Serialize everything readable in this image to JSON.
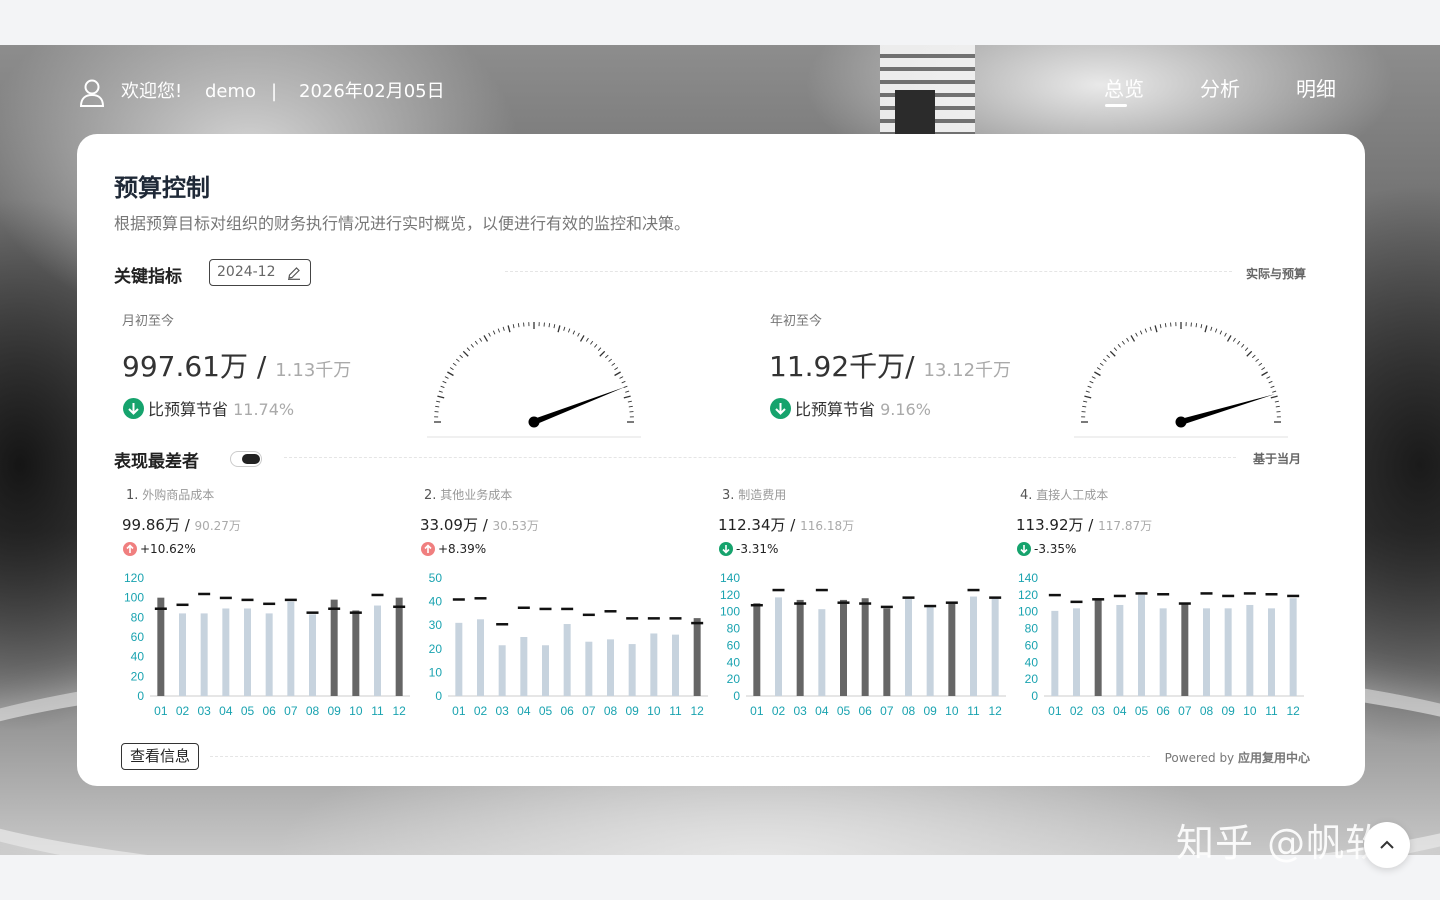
{
  "header": {
    "welcome": "欢迎您!",
    "username": "demo",
    "separator": "|",
    "date": "2026年02月05日",
    "nav": [
      {
        "label": "总览",
        "active": true
      },
      {
        "label": "分析",
        "active": false
      },
      {
        "label": "明细",
        "active": false
      }
    ]
  },
  "page": {
    "title": "预算控制",
    "subtitle": "根据预算目标对组织的财务执行情况进行实时概览，以便进行有效的监控和决策。"
  },
  "key_metrics": {
    "label": "关键指标",
    "period": "2024-12",
    "right_tag": "实际与预算",
    "mtd": {
      "label": "月初至今",
      "actual": "997.61万",
      "sep": " / ",
      "budget": "1.13千万",
      "status_text": "比预算节省",
      "status_pct": "11.74%",
      "gauge_ratio": 0.883
    },
    "ytd": {
      "label": "年初至今",
      "actual": "11.92千万",
      "sep": "/ ",
      "budget": "13.12千万",
      "status_text": "比预算节省",
      "status_pct": "9.16%",
      "gauge_ratio": 0.908
    }
  },
  "worst": {
    "label": "表现最差者",
    "right_tag": "基于当月",
    "items": [
      {
        "idx": "1.",
        "name": "外购商品成本",
        "actual": "99.86万",
        "budget": "90.27万",
        "change": "+10.62%",
        "direction": "up"
      },
      {
        "idx": "2.",
        "name": "其他业务成本",
        "actual": "33.09万",
        "budget": "30.53万",
        "change": "+8.39%",
        "direction": "up"
      },
      {
        "idx": "3.",
        "name": "制造费用",
        "actual": "112.34万",
        "budget": "116.18万",
        "change": "-3.31%",
        "direction": "down"
      },
      {
        "idx": "4.",
        "name": "直接人工成本",
        "actual": "113.92万",
        "budget": "117.87万",
        "change": "-3.35%",
        "direction": "down"
      }
    ]
  },
  "chart_data": [
    {
      "type": "bar",
      "categories": [
        "01",
        "02",
        "03",
        "04",
        "05",
        "06",
        "07",
        "08",
        "09",
        "10",
        "11",
        "12"
      ],
      "ylim": [
        0,
        120
      ],
      "yticks": [
        0,
        20,
        40,
        60,
        80,
        100,
        120
      ],
      "series": [
        {
          "values": [
            100,
            84,
            84,
            89,
            89,
            84,
            96,
            83,
            98,
            87,
            92,
            100
          ]
        },
        {
          "values": [
            89,
            93,
            104,
            100,
            98,
            94,
            98,
            85,
            89,
            85,
            103,
            91
          ]
        }
      ],
      "highlight": [
        true,
        false,
        false,
        false,
        false,
        false,
        false,
        false,
        true,
        true,
        false,
        true
      ]
    },
    {
      "type": "bar",
      "categories": [
        "01",
        "02",
        "03",
        "04",
        "05",
        "06",
        "07",
        "08",
        "09",
        "10",
        "11",
        "12"
      ],
      "ylim": [
        0,
        50
      ],
      "yticks": [
        0,
        10,
        20,
        30,
        40,
        50
      ],
      "series": [
        {
          "values": [
            31,
            32.5,
            21.5,
            25,
            21.5,
            30.5,
            23,
            24,
            22,
            26.5,
            26,
            33
          ]
        },
        {
          "values": [
            41,
            41.5,
            30.5,
            37.5,
            37,
            37,
            34.5,
            36,
            33,
            33,
            33,
            31
          ]
        }
      ],
      "highlight": [
        false,
        false,
        false,
        false,
        false,
        false,
        false,
        false,
        false,
        false,
        false,
        true
      ]
    },
    {
      "type": "bar",
      "categories": [
        "01",
        "02",
        "03",
        "04",
        "05",
        "06",
        "07",
        "08",
        "09",
        "10",
        "11",
        "12"
      ],
      "ylim": [
        0,
        140
      ],
      "yticks": [
        0,
        20,
        40,
        60,
        80,
        100,
        120,
        140
      ],
      "series": [
        {
          "values": [
            110,
            117,
            114,
            103,
            114,
            116,
            104,
            115,
            107,
            112,
            118,
            116
          ]
        },
        {
          "values": [
            108,
            126,
            110,
            126,
            111,
            110,
            106,
            117,
            107,
            111,
            126,
            117
          ]
        }
      ],
      "highlight": [
        true,
        false,
        true,
        false,
        true,
        true,
        true,
        false,
        false,
        true,
        false,
        false
      ]
    },
    {
      "type": "bar",
      "categories": [
        "01",
        "02",
        "03",
        "04",
        "05",
        "06",
        "07",
        "08",
        "09",
        "10",
        "11",
        "12"
      ],
      "ylim": [
        0,
        140
      ],
      "yticks": [
        0,
        20,
        40,
        60,
        80,
        100,
        120,
        140
      ],
      "series": [
        {
          "values": [
            101,
            104,
            116,
            108,
            120,
            104,
            110,
            104,
            104,
            108,
            104,
            116
          ]
        },
        {
          "values": [
            120,
            112,
            115,
            119,
            122,
            121,
            110,
            122,
            119,
            122,
            121,
            119
          ]
        }
      ],
      "highlight": [
        false,
        false,
        true,
        false,
        false,
        false,
        true,
        false,
        false,
        false,
        false,
        false
      ]
    }
  ],
  "footer": {
    "info_button": "查看信息",
    "powered_prefix": "Powered by ",
    "powered_name": "应用复用中心"
  },
  "watermark": "知乎 @帆软",
  "colors": {
    "bar_light": "#c7d3de",
    "bar_dark": "#666666",
    "axis_text": "#1aa3b0",
    "save_green": "#16a36d",
    "over_red": "#f07f7f"
  }
}
